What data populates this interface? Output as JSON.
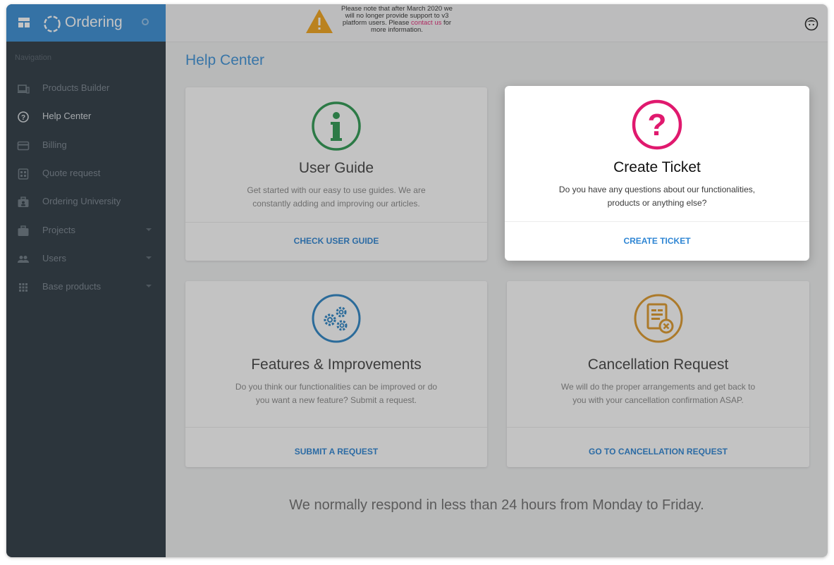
{
  "brand": {
    "name": "Ordering"
  },
  "notice": {
    "text_before": "Please note that after March 2020 we will no longer provide support to v3 platform users. Please",
    "link": "contact us",
    "text_after": "for more information."
  },
  "sidebar": {
    "heading": "Navigation",
    "items": [
      {
        "label": "Products Builder",
        "icon": "laptop-icon"
      },
      {
        "label": "Help Center",
        "icon": "help-circle-icon"
      },
      {
        "label": "Billing",
        "icon": "credit-card-icon"
      },
      {
        "label": "Quote request",
        "icon": "calculator-icon"
      },
      {
        "label": "Ordering University",
        "icon": "briefcase-person-icon"
      },
      {
        "label": "Projects",
        "icon": "briefcase-icon"
      },
      {
        "label": "Users",
        "icon": "people-icon"
      },
      {
        "label": "Base products",
        "icon": "grid-icon"
      }
    ]
  },
  "page": {
    "title": "Help Center"
  },
  "cards": {
    "user_guide": {
      "title": "User Guide",
      "desc": "Get started with our easy to use guides. We are constantly adding and improving our articles.",
      "action": "CHECK USER GUIDE",
      "icon": "info-icon"
    },
    "create_ticket": {
      "title": "Create Ticket",
      "desc": "Do you have any questions about our functionalities, products or anything else?",
      "action": "CREATE TICKET",
      "icon": "question-icon"
    },
    "features": {
      "title": "Features & Improvements",
      "desc": "Do you think our functionalities can be improved or do you want a new feature? Submit a request.",
      "action": "SUBMIT A REQUEST",
      "icon": "gears-icon"
    },
    "cancellation": {
      "title": "Cancellation Request",
      "desc": "We will do the proper arrangements and get back to you with your cancellation confirmation ASAP.",
      "action": "GO TO CANCELLATION REQUEST",
      "icon": "document-cancel-icon"
    }
  },
  "footer_note": "We normally respond in less than 24 hours from Monday to Friday.",
  "colors": {
    "accent": "#3f93d9",
    "ticket": "#e0196e",
    "guide": "#2e9a52",
    "features": "#2d86c6",
    "cancellation": "#e09a2c",
    "sidebar": "#2f3b45"
  }
}
